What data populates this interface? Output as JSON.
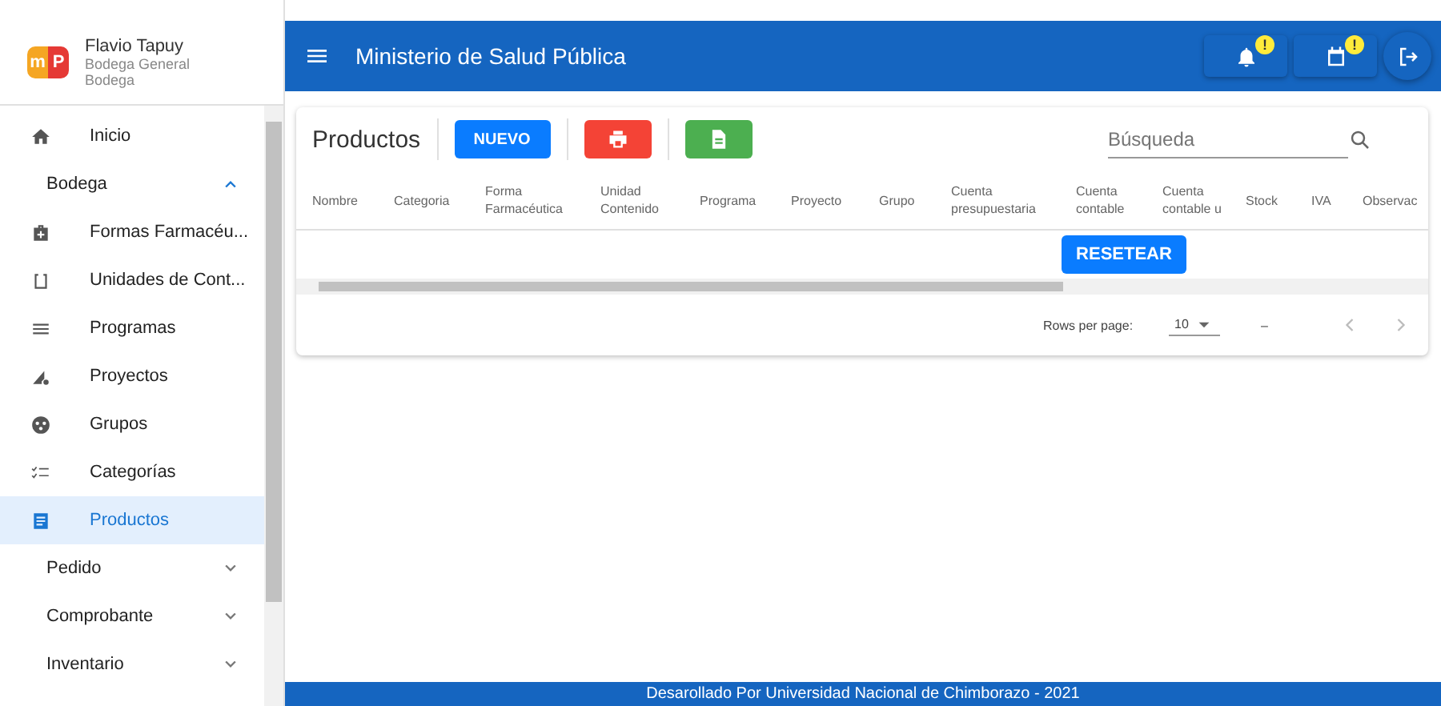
{
  "user": {
    "name": "Flavio Tapuy",
    "role": "Bodega General",
    "area": "Bodega",
    "logo": [
      "m",
      "P"
    ]
  },
  "nav": [
    {
      "kind": "link",
      "label": "Inicio",
      "selected": false
    },
    {
      "kind": "group",
      "label": "Bodega",
      "expanded": true,
      "children": [
        {
          "label": "Formas Farmacéu...",
          "selected": false
        },
        {
          "label": "Unidades de Cont...",
          "selected": false
        },
        {
          "label": "Programas",
          "selected": false
        },
        {
          "label": "Proyectos",
          "selected": false
        },
        {
          "label": "Grupos",
          "selected": false
        },
        {
          "label": "Categorías",
          "selected": false
        },
        {
          "label": "Productos",
          "selected": true
        }
      ]
    },
    {
      "kind": "group",
      "label": "Pedido",
      "expanded": false
    },
    {
      "kind": "group",
      "label": "Comprobante",
      "expanded": false
    },
    {
      "kind": "group",
      "label": "Inventario",
      "expanded": false
    }
  ],
  "app_bar": {
    "title": "Ministerio de Salud Pública",
    "badges": [
      "!",
      "!"
    ]
  },
  "card": {
    "title": "Productos",
    "new_button": "NUEVO",
    "search": {
      "placeholder": "Búsqueda"
    },
    "columns": [
      "Nombre",
      "Categoria",
      "Forma Farmacéutica",
      "Unidad Contenido",
      "Programa",
      "Proyecto",
      "Grupo",
      "Cuenta presupuestaria",
      "Cuenta contable",
      "Cuenta contable u",
      "Stock",
      "IVA",
      "Observac"
    ],
    "reset_button": "RESETEAR",
    "footer": {
      "rows_label": "Rows per page:",
      "rows_value": "10",
      "range": "–"
    }
  },
  "status_bar": "Desarollado Por Universidad Nacional de Chimborazo - 2021"
}
